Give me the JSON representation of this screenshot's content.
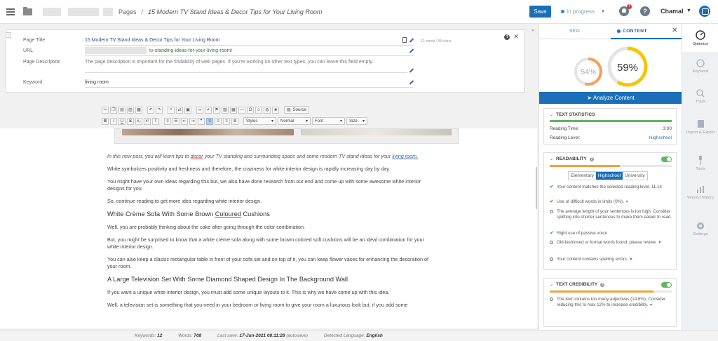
{
  "topbar": {
    "breadcrumb_section": "Pages",
    "breadcrumb_sep": "/",
    "breadcrumb_title": "15 Modern TV Stand Ideas & Decor Tips for Your Living Room",
    "save_label": "Save",
    "status_label": "In progress",
    "notification_count": "1",
    "help_glyph": "?",
    "user_name": "Chamal"
  },
  "meta": {
    "title_label": "Page Title",
    "title_value": "15 Modern TV Stand Ideas & Decor Tips for Your Living Room",
    "title_count": "12 words / 58 chars",
    "url_label": "URL",
    "url_value": "tv-standing-ideas-for-your-living-room/",
    "desc_label": "Page Description",
    "desc_placeholder": "The page description is important for the findability of web pages. If you're working on other text types, you can leave this field empty.",
    "keyword_label": "Keyword",
    "keyword_value": "living room"
  },
  "toolbar": {
    "source_label": "Source",
    "styles_label": "Styles",
    "format_label": "Normal",
    "font_label": "Font",
    "size_label": "Size"
  },
  "article": {
    "intro_prefix": "In this new post, you will learn tips to ",
    "intro_decor": "decor",
    "intro_middle": " your TV standing and surrounding space and some modern TV stand ideas for your ",
    "intro_link": "living room.",
    "p1": "White symbolizes positivity and freshness and therefore, the craziness for white interior design is rapidly increasing day by day.",
    "p2": "You might have your own ideas regarding this but, we also have done research from our end and come up with some awesome white interior designs for you.",
    "p3": "So, continue reading to get more idea regarding white interior design.",
    "h1_prefix": "White Crème Sofa With Some Brown ",
    "h1_underlined": "Coloured",
    "h1_suffix": " Cushions",
    "p4": "Well, you are probably thinking about the cake after going through the color combination.",
    "p5": "But, you might be surprised to know that a white crème sofa along with some brown colored soft cushions will be an ideal combination for your white interior design.",
    "p6": "You can also keep a classic rectangular table in front of your sofa set and on top of it, you can keep flower vases for enhancing the decoration of your room.",
    "h2": "A Large Television Set With Some Diamond Shaped Design In The Background Wall",
    "p7": "If you want a unique white interior design, you must add some unique layouts to it. This is why we have come up with this idea.",
    "p8": "Well, a television set is something that you need in your bedroom or living room to give your room a luxurious look but, if you add some"
  },
  "statusbar": {
    "keywords_label": "Keywords:",
    "keywords_value": "12",
    "words_label": "Words:",
    "words_value": "708",
    "last_save_label": "Last save:",
    "last_save_value": "17-Jun-2021 08:11:28",
    "autosave": "(autosave)",
    "language_label": "Detected Language:",
    "language_value": "English"
  },
  "seo_panel": {
    "collapse_glyph": "»",
    "tab_seo": "SEO",
    "tab_content": "CONTENT",
    "score_small": "54%",
    "score_small_value": 54,
    "score_big": "59%",
    "score_big_value": 59,
    "analyze_label": "Analyze Content",
    "text_statistics": {
      "title": "TEXT STATISTICS",
      "reading_time_label": "Reading Time:",
      "reading_time_value": "3:00",
      "reading_level_label": "Reading Level:",
      "reading_level_value": "Highschool"
    },
    "readability": {
      "title": "READABILITY",
      "levels": [
        "Elementary",
        "Highschool",
        "University"
      ],
      "item1": "Your content matches the selected reading level. 11.14",
      "item2": "Use of difficult words in limits (0%).",
      "item3": "The average length of your sentences is too high. Consider splitting into shorter sentences to make them easier to read.",
      "item4": "Right use of passive voice",
      "item5": "Old-fashioned or formal words found, please review.",
      "item6": "Your content contains spelling errors."
    },
    "credibility": {
      "title": "TEXT CREDIBILITY",
      "item1": "The text contains too many adjectives (14.6%). Consider reducing this to max 12% to increase credibility."
    }
  },
  "right_nav": {
    "items": [
      "Optimize",
      "Keyword",
      "Track",
      "Import & Export",
      "Tools",
      "Version history",
      "Settings"
    ]
  },
  "colors": {
    "accent": "#1a6fb8",
    "score_small": "#f5a05a",
    "score_big": "#f7c600",
    "ok": "#5cb85c"
  }
}
